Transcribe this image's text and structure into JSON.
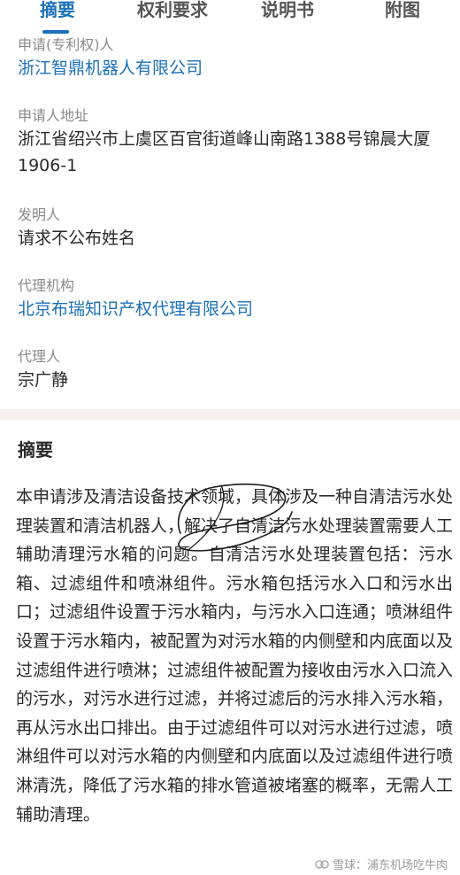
{
  "tabs": [
    "摘要",
    "权利要求",
    "说明书",
    "附图"
  ],
  "applicant": {
    "label": "申请(专利权)人",
    "value": "浙江智鼎机器人有限公司"
  },
  "address": {
    "label": "申请人地址",
    "value": "浙江省绍兴市上虞区百官街道峰山南路1388号锦晨大厦1906-1"
  },
  "inventor": {
    "label": "发明人",
    "value": "请求不公布姓名"
  },
  "agency": {
    "label": "代理机构",
    "value": "北京布瑞知识产权代理有限公司"
  },
  "agent": {
    "label": "代理人",
    "value": "宗广静"
  },
  "abstract": {
    "title": "摘要",
    "text": "本申请涉及清洁设备技术领域，具体涉及一种自清洁污水处理装置和清洁机器人，解决了自清洁污水处理装置需要人工辅助清理污水箱的问题。自清洁污水处理装置包括：污水箱、过滤组件和喷淋组件。污水箱包括污水入口和污水出口；过滤组件设置于污水箱内，与污水入口连通；喷淋组件设置于污水箱内，被配置为对污水箱的内侧壁和内底面以及过滤组件进行喷淋；过滤组件被配置为接收由污水入口流入的污水，对污水进行过滤，并将过滤后的污水排入污水箱，再从污水出口排出。由于过滤组件可以对污水进行过滤，喷淋组件可以对污水箱的内侧壁和内底面以及过滤组件进行喷淋清洗，降低了污水箱的排水管道被堵塞的概率，无需人工辅助清理。"
  },
  "watermark": "雪球：浦东机场吃牛肉",
  "colors": {
    "accent": "#1c70b8",
    "divider": "#f7eeee"
  }
}
